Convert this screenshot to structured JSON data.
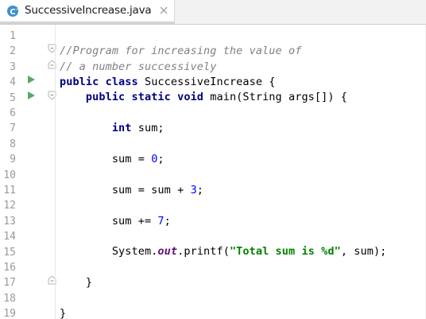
{
  "tab": {
    "file_name": "SuccessiveIncrease.java",
    "icon": "java-class-icon",
    "icon_letter": "C"
  },
  "editor": {
    "line_numbers": [
      "1",
      "2",
      "3",
      "4",
      "5",
      "6",
      "7",
      "8",
      "9",
      "10",
      "11",
      "12",
      "13",
      "14",
      "15",
      "16",
      "17",
      "18",
      "19"
    ],
    "run_markers_on_lines": [
      4,
      5
    ],
    "fold_markers_on_lines": [
      2,
      3,
      5,
      17
    ],
    "code": {
      "l2_comment": "//Program for increasing the value of",
      "l3_comment": "// a number successively",
      "l4_kw": "public class",
      "l4_rest": " SuccessiveIncrease {",
      "l5_indent": "    ",
      "l5_kw": "public static void",
      "l5_rest": " main(String args[]) {",
      "l7_indent": "        ",
      "l7_kw": "int",
      "l7_rest": " sum;",
      "l9_a": "        sum = ",
      "l9_num": "0",
      "l9_b": ";",
      "l11_a": "        sum = sum + ",
      "l11_num": "3",
      "l11_b": ";",
      "l13_a": "        sum += ",
      "l13_num": "7",
      "l13_b": ";",
      "l15_a": "        System.",
      "l15_field": "out",
      "l15_b": ".printf(",
      "l15_str": "\"Total sum is %d\"",
      "l15_c": ", sum);",
      "l17": "    }",
      "l19": "}"
    }
  },
  "colors": {
    "keyword": "#000080",
    "comment": "#808080",
    "number": "#0000ff",
    "string": "#008000",
    "field": "#660e7a",
    "line_number": "#999999",
    "run_marker": "#59a869"
  }
}
